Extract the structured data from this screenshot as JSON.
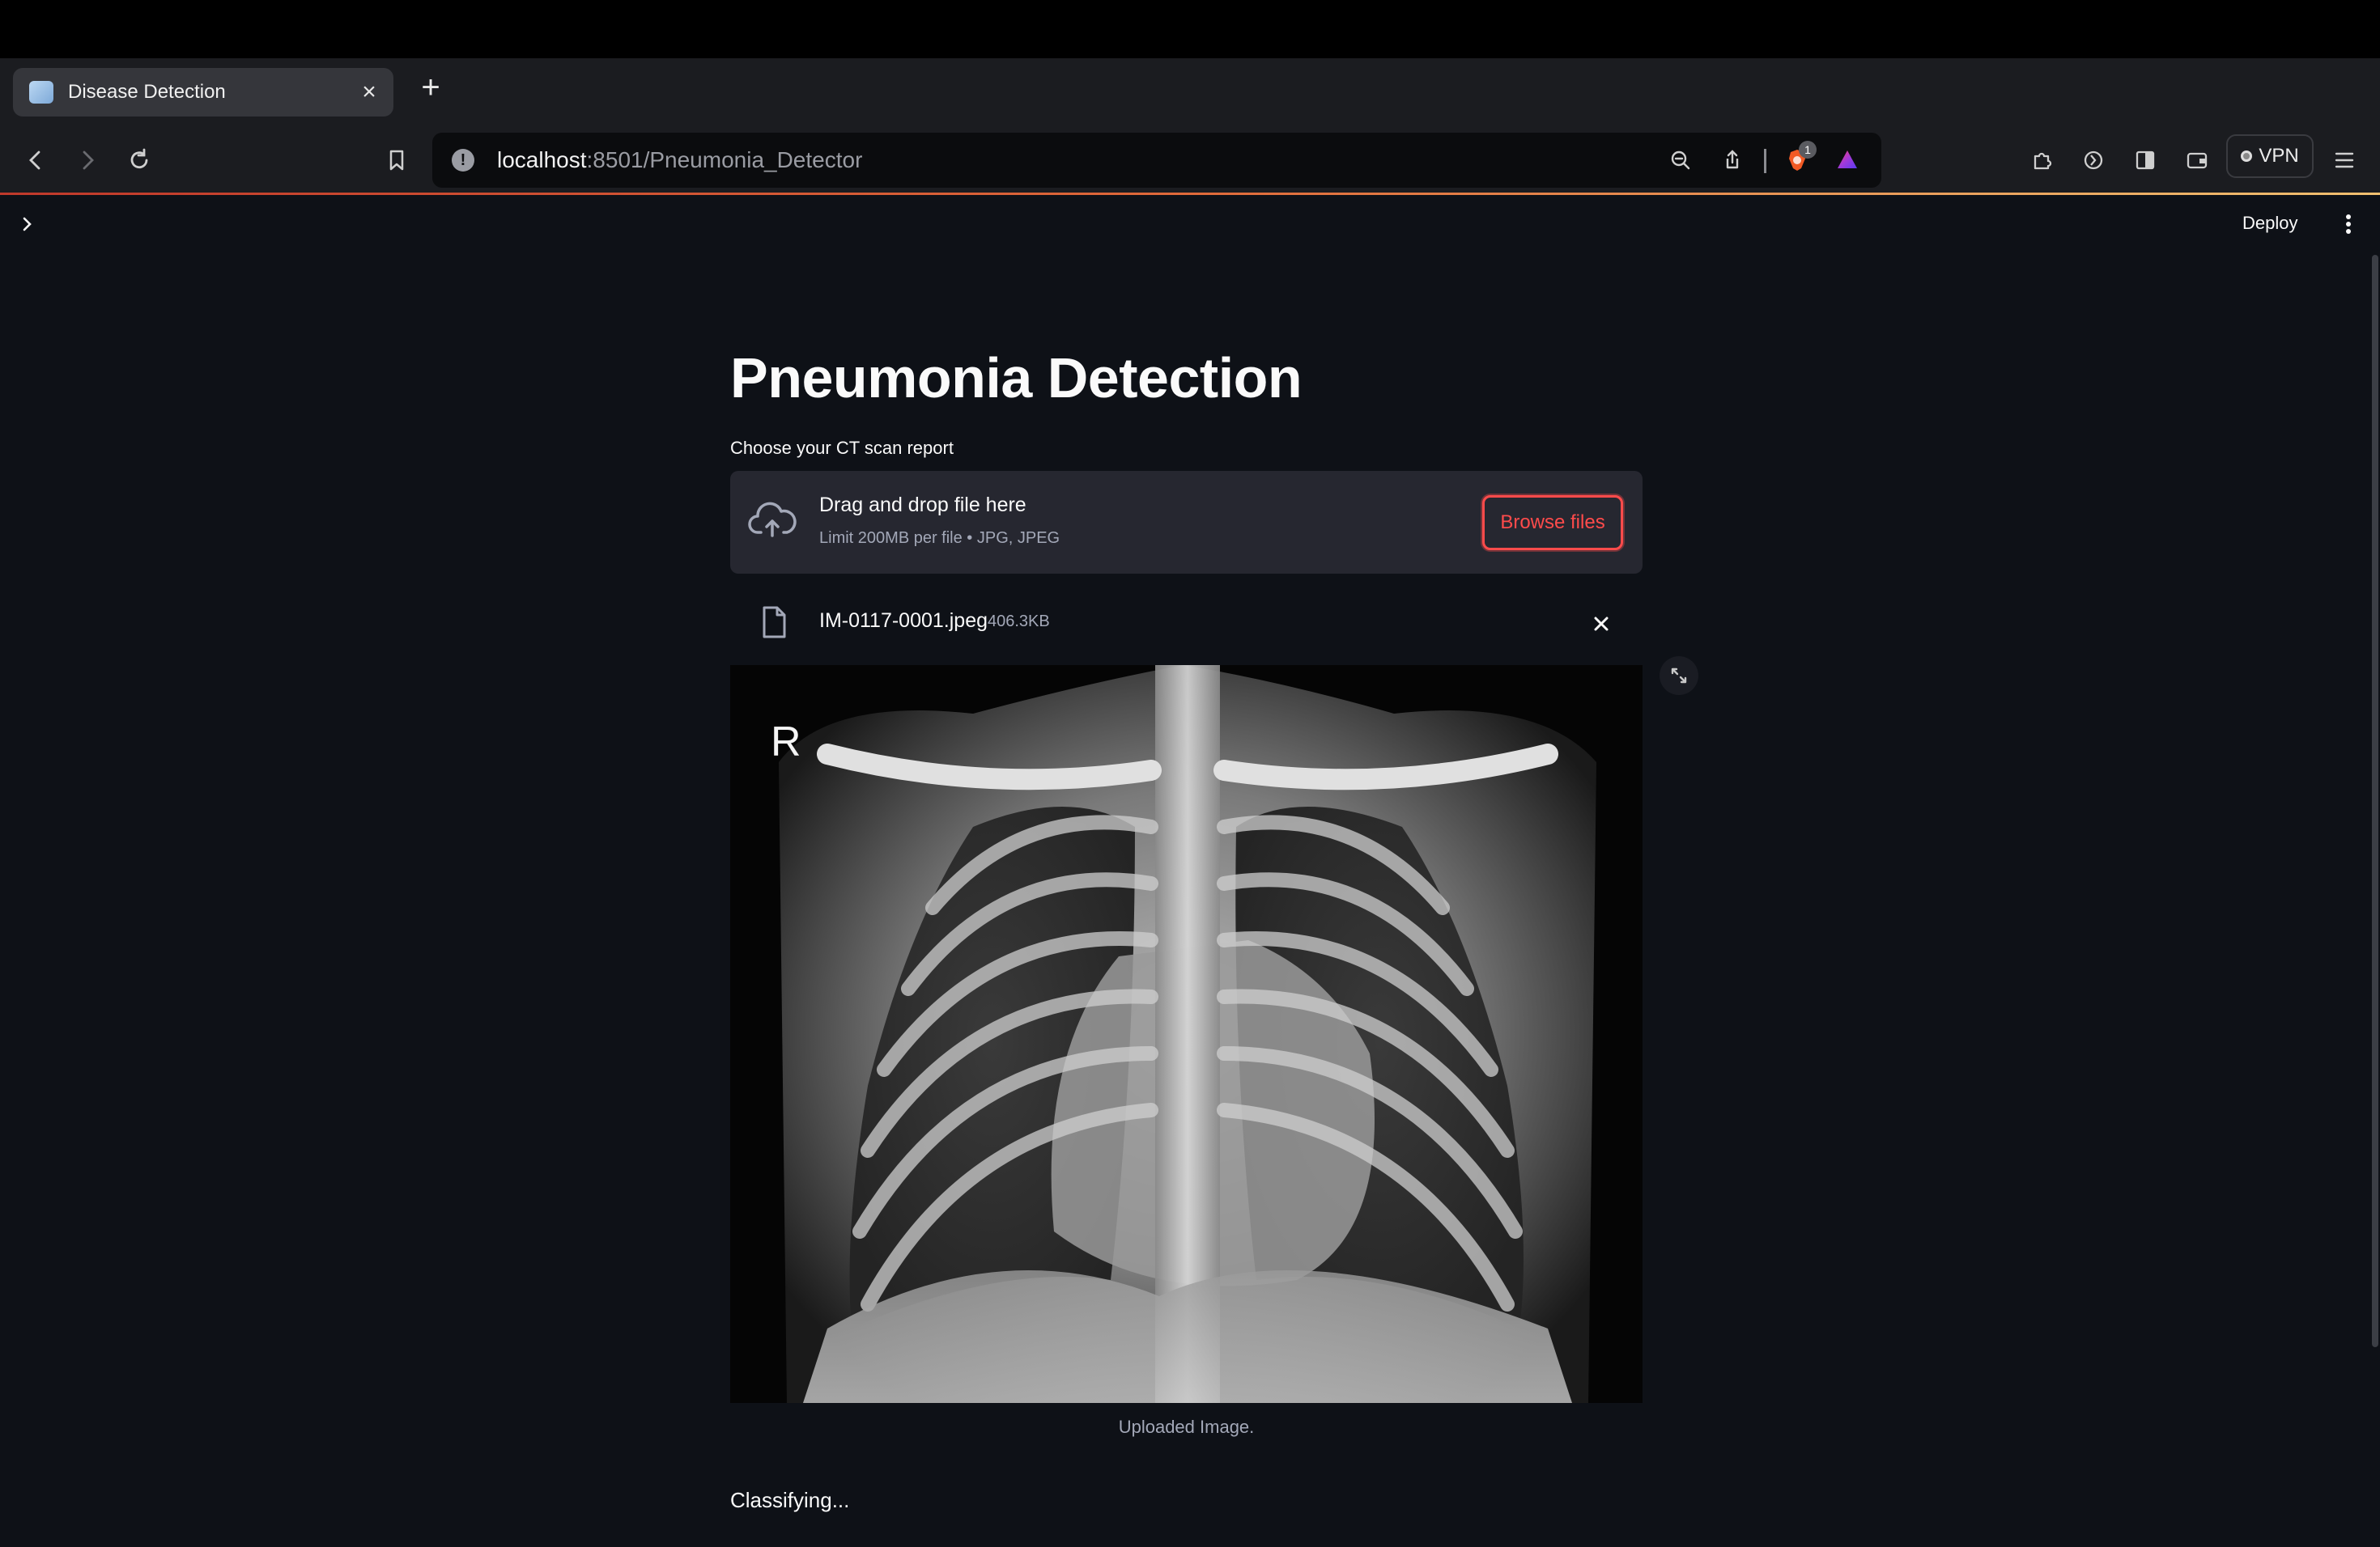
{
  "browser": {
    "tab_title": "Disease Detection",
    "url_host": "localhost",
    "url_path": ":8501/Pneumonia_Detector",
    "shields_badge": "1",
    "vpn_label": "VPN"
  },
  "app": {
    "deploy_label": "Deploy",
    "title": "Pneumonia Detection",
    "uploader_label": "Choose your CT scan report",
    "dropzone": {
      "title": "Drag and drop file here",
      "subtitle": "Limit 200MB per file • JPG, JPEG",
      "browse_label": "Browse files"
    },
    "file": {
      "name": "IM-0117-0001.jpeg",
      "size": "406.3KB"
    },
    "image": {
      "marker": "R"
    },
    "caption": "Uploaded Image.",
    "status": "Classifying..."
  },
  "colors": {
    "background": "#0e1117",
    "accent": "#ff4b4b",
    "surface": "#262730"
  }
}
